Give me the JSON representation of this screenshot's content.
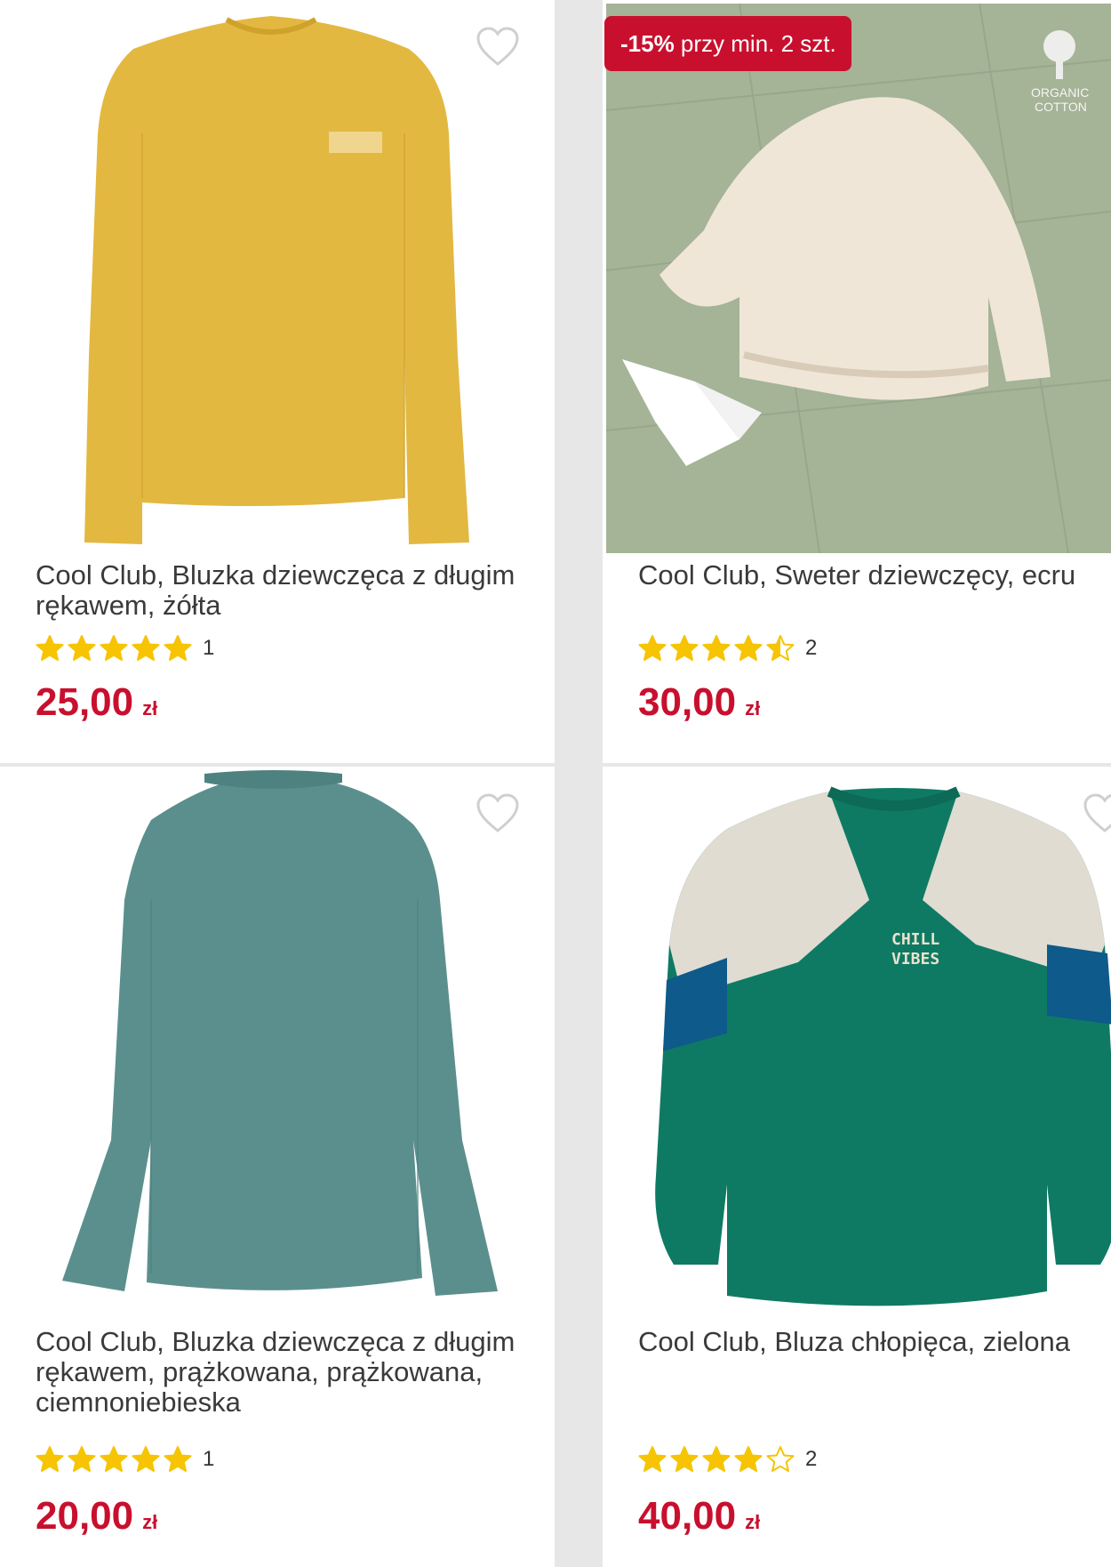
{
  "colors": {
    "accent": "#c8102e",
    "star": "#f6c400"
  },
  "products": [
    {
      "title": "Cool Club, Bluzka dziewczęca z długim rękawem, żółta",
      "stars": 5,
      "rating_count": "1",
      "price_amount": "25,00",
      "price_currency": "zł",
      "image": "yellow-longsleeve-top"
    },
    {
      "badge_pct": "-15%",
      "badge_rest": " przy min. 2 szt.",
      "title": "Cool Club, Sweter dziewczęcy, ecru",
      "stars": 4.5,
      "rating_count": "2",
      "price_amount": "30,00",
      "price_currency": "zł",
      "image": "ecru-knit-sweater",
      "logo_text": [
        "ORGANIC",
        "COTTON"
      ]
    },
    {
      "title": "Cool Club, Bluzka dziewczęca z długim rękawem, prążkowana, prążkowana, ciemnoniebieska",
      "stars": 5,
      "rating_count": "1",
      "price_amount": "20,00",
      "price_currency": "zł",
      "image": "teal-ribbed-top"
    },
    {
      "title": "Cool Club, Bluza chłopięca, zielona",
      "stars": 4,
      "rating_count": "2",
      "price_amount": "40,00",
      "price_currency": "zł",
      "image": "green-sweatshirt",
      "print_text": [
        "CHILL",
        "VIBES"
      ]
    }
  ]
}
